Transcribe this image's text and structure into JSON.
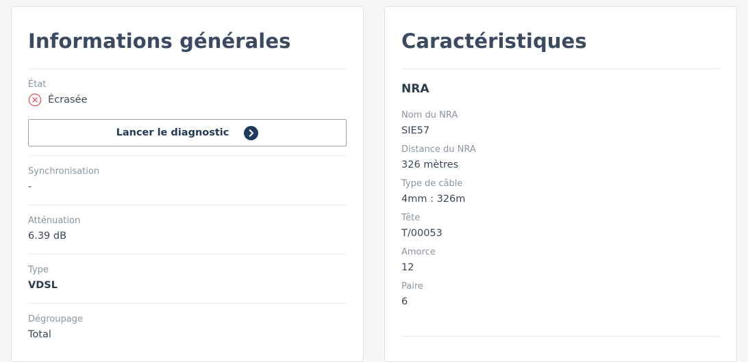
{
  "general": {
    "title": "Informations générales",
    "state": {
      "label": "État",
      "value": "Écrasée",
      "icon": "error-circle-icon",
      "icon_color": "#e05260"
    },
    "diagnostic_button": {
      "label": "Lancer le diagnostic",
      "icon": "chevron-right-circle-icon",
      "icon_color": "#1d3b5c"
    },
    "fields": [
      {
        "label": "Synchronisation",
        "value": "-"
      },
      {
        "label": "Atténuation",
        "value": "6.39 dB"
      },
      {
        "label": "Type",
        "value": "VDSL"
      },
      {
        "label": "Dégroupage",
        "value": "Total"
      }
    ]
  },
  "characteristics": {
    "title": "Caractéristiques",
    "section": "NRA",
    "fields": [
      {
        "label": "Nom du NRA",
        "value": "SIE57"
      },
      {
        "label": "Distance du NRA",
        "value": "326 mètres"
      },
      {
        "label": "Type de câble",
        "value": "4mm : 326m"
      },
      {
        "label": "Tête",
        "value": "T/00053"
      },
      {
        "label": "Amorce",
        "value": "12"
      },
      {
        "label": "Paire",
        "value": "6"
      }
    ]
  }
}
